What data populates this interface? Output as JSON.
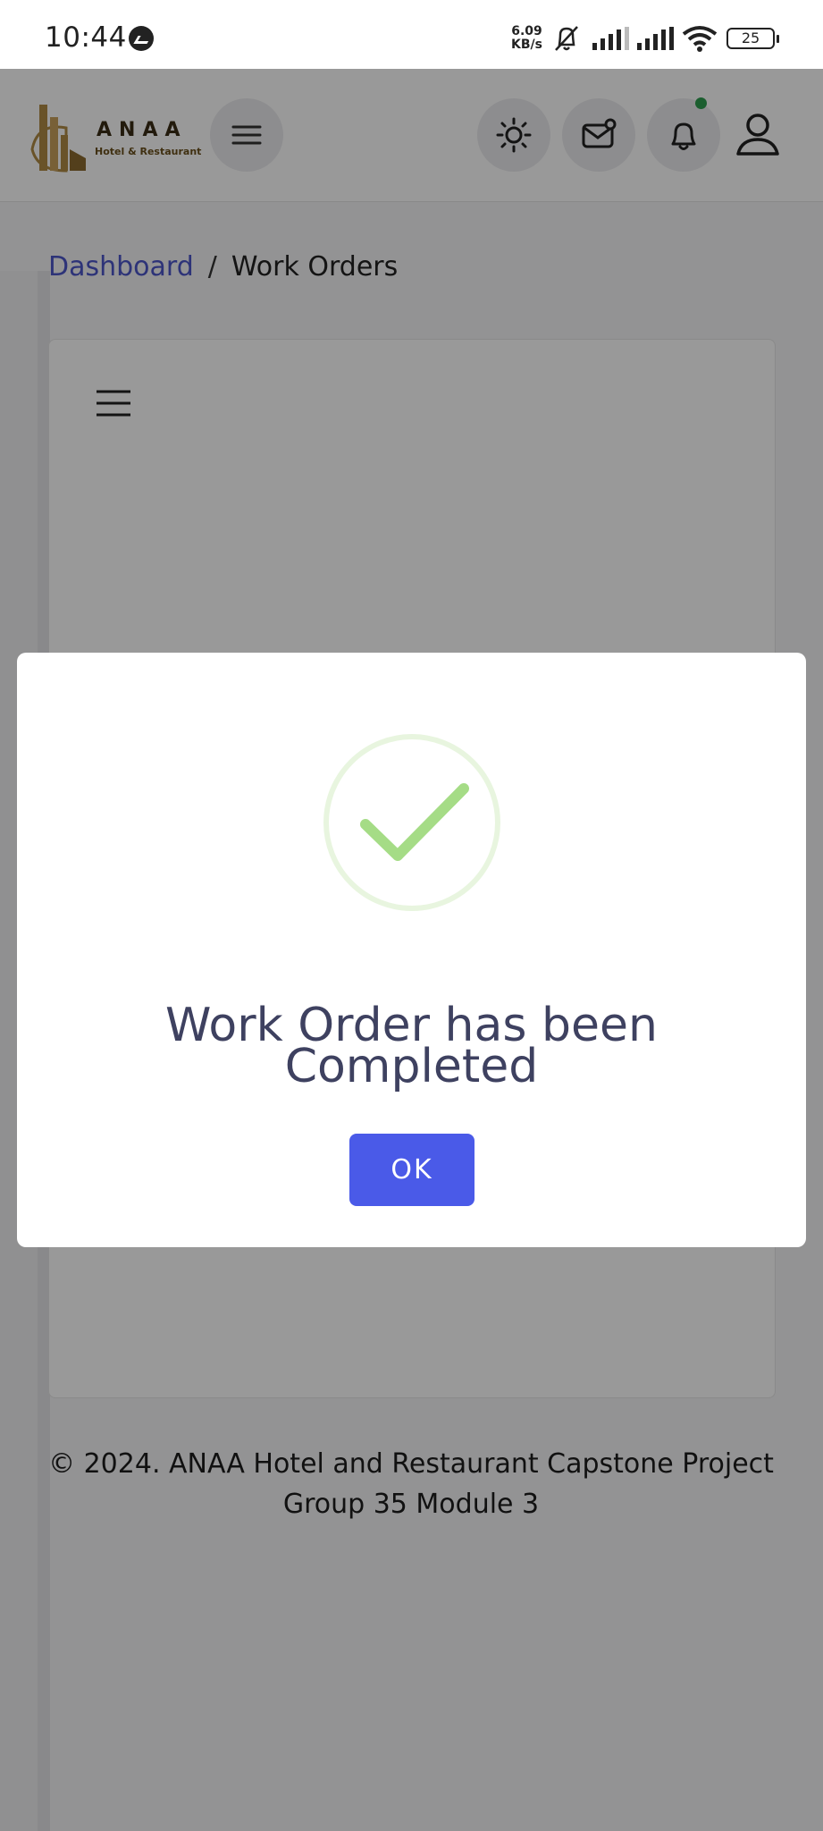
{
  "status_bar": {
    "time": "10:44",
    "net_speed_value": "6.09",
    "net_speed_unit": "KB/s",
    "battery": "25"
  },
  "header": {
    "brand_name": "ANAA",
    "brand_tagline": "Hotel & Restaurant"
  },
  "breadcrumb": {
    "home": "Dashboard",
    "separator": "/",
    "current": "Work Orders"
  },
  "footer": {
    "line1": "© 2024. ANAA Hotel and Restaurant Capstone Project",
    "line2": "Group 35 Module 3"
  },
  "modal": {
    "title": "Work Order has been Completed",
    "ok_label": "OK",
    "icon": "success-check-icon",
    "icon_color": "#a5dc86"
  },
  "colors": {
    "accent": "#4a5ae8",
    "link": "#4b55c9",
    "notification_dot": "#2e9d4f"
  }
}
